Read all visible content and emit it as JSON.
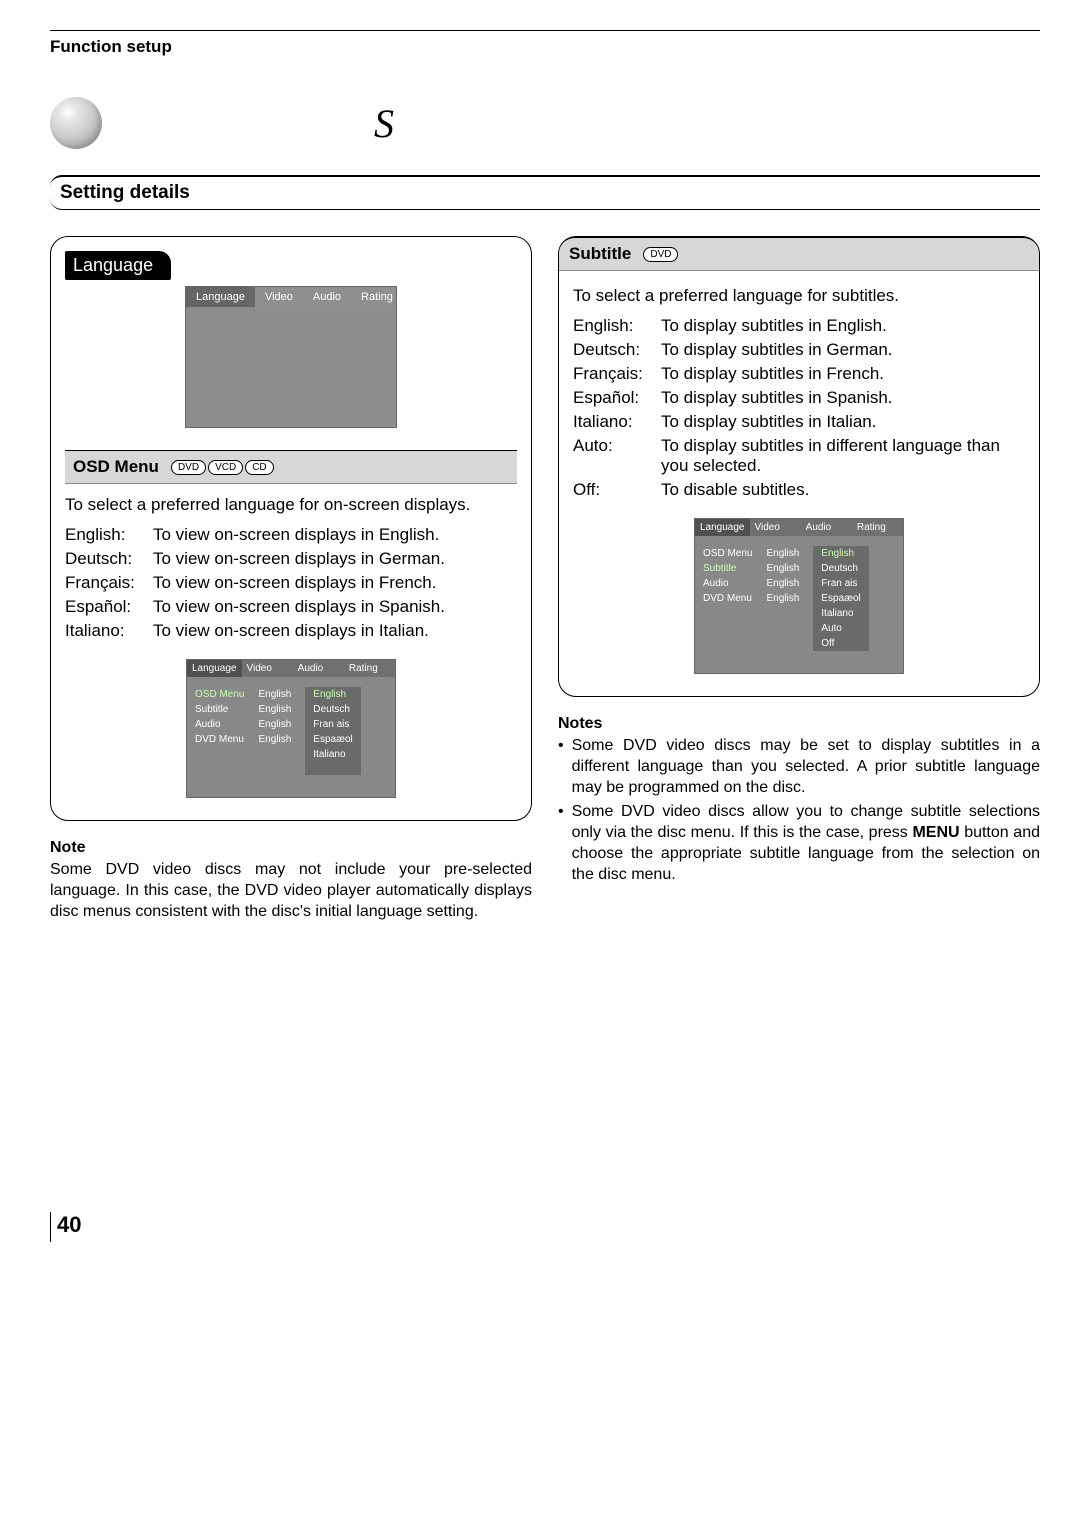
{
  "header": {
    "section": "Function setup",
    "title_char": "S"
  },
  "setting_bar": "Setting details",
  "left": {
    "lang_tab": "Language",
    "osd_screen_tabs": [
      "Language",
      "Video",
      "Audio",
      "Rating"
    ],
    "osd_menu": {
      "label": "OSD Menu",
      "discs": [
        "DVD",
        "VCD",
        "CD"
      ],
      "desc": "To select a preferred language for on-screen displays.",
      "items": [
        {
          "k": "English:",
          "v": "To view on-screen displays in English."
        },
        {
          "k": "Deutsch:",
          "v": "To view on-screen displays in German."
        },
        {
          "k": "Français:",
          "v": "To view on-screen displays in French."
        },
        {
          "k": "Español:",
          "v": "To view on-screen displays in Spanish."
        },
        {
          "k": "Italiano:",
          "v": "To view on-screen displays in Italian."
        }
      ]
    },
    "mini": {
      "tabs": [
        "Language",
        "Video",
        "Audio",
        "Rating"
      ],
      "rows": [
        "OSD Menu",
        "Subtitle",
        "Audio",
        "DVD Menu"
      ],
      "vals": [
        "English",
        "English",
        "English",
        "English"
      ],
      "opts": [
        "English",
        "Deutsch",
        "Fran ais",
        "Espaæol",
        "Italiano"
      ]
    },
    "note_title": "Note",
    "note": "Some DVD video discs may not include your pre-selected language. In this case, the DVD video player automatically displays disc menus consistent with the disc's initial language setting."
  },
  "right": {
    "subtitle": {
      "label": "Subtitle",
      "discs": [
        "DVD"
      ],
      "desc": "To select a preferred language for subtitles.",
      "items": [
        {
          "k": "English:",
          "v": "To display subtitles in English."
        },
        {
          "k": "Deutsch:",
          "v": "To display subtitles in German."
        },
        {
          "k": "Français:",
          "v": "To display subtitles in French."
        },
        {
          "k": "Español:",
          "v": "To display subtitles in Spanish."
        },
        {
          "k": "Italiano:",
          "v": "To display subtitles in Italian."
        },
        {
          "k": "Auto:",
          "v": "To display subtitles in different language than you selected."
        },
        {
          "k": "Off:",
          "v": "To disable subtitles."
        }
      ]
    },
    "mini": {
      "tabs": [
        "Language",
        "Video",
        "Audio",
        "Rating"
      ],
      "rows": [
        "OSD Menu",
        "Subtitle",
        "Audio",
        "DVD Menu"
      ],
      "vals": [
        "English",
        "English",
        "English",
        "English"
      ],
      "opts": [
        "English",
        "Deutsch",
        "Fran ais",
        "Espaæol",
        "Italiano",
        "Auto",
        "Off"
      ]
    },
    "notes_title": "Notes",
    "notes": [
      "Some DVD video discs may be set to display subtitles in a different language than you selected. A prior subtitle language may be programmed on the disc.",
      "Some DVD video discs allow you to change subtitle selections only via the disc menu. If this is the case, press MENU button and choose the appropriate subtitle language from the selection on the disc menu."
    ],
    "notes_html": [
      "Some DVD video discs may be set to display subtitles in a different language than you selected. A prior subtitle language may be programmed on the disc.",
      "Some DVD video discs allow you to change subtitle selections only via the disc menu. If this is the case, press <b>MENU</b> button and choose the appropriate subtitle language from the selection on the disc menu."
    ]
  },
  "page_number": "40"
}
